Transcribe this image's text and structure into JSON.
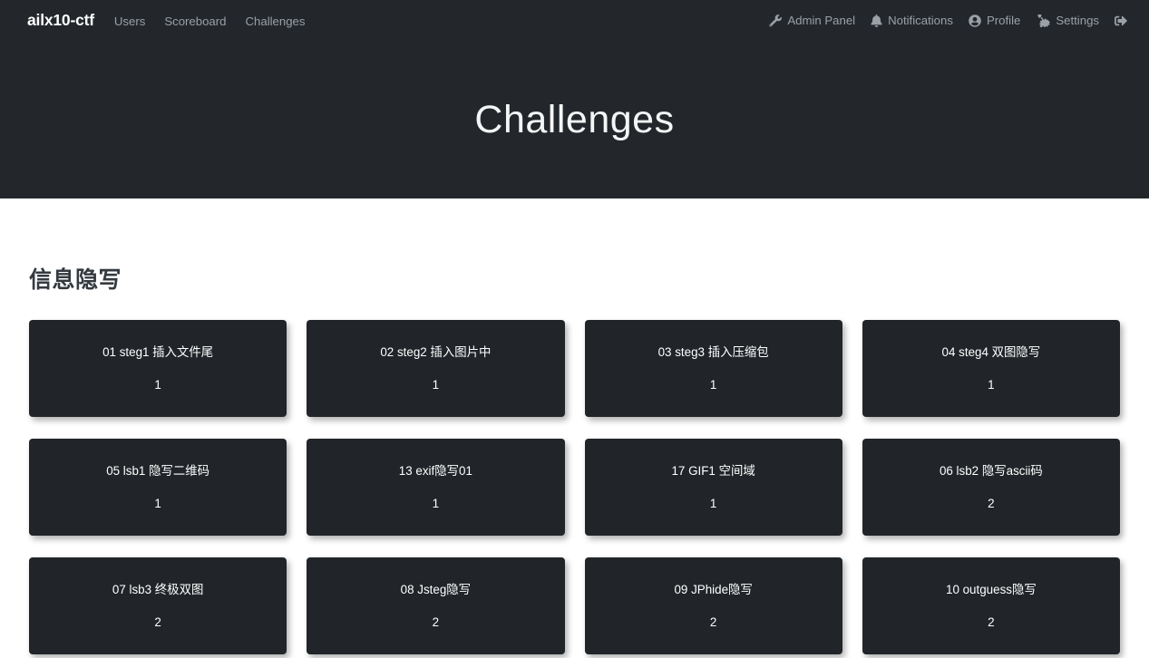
{
  "navbar": {
    "brand": "ailx10-ctf",
    "left_links": [
      {
        "label": "Users",
        "name": "nav-link-users"
      },
      {
        "label": "Scoreboard",
        "name": "nav-link-scoreboard"
      },
      {
        "label": "Challenges",
        "name": "nav-link-challenges"
      }
    ],
    "right_items": [
      {
        "label": "Admin Panel",
        "icon": "wrench-icon"
      },
      {
        "label": "Notifications",
        "icon": "bell-icon"
      },
      {
        "label": "Profile",
        "icon": "user-circle-icon"
      },
      {
        "label": "Settings",
        "icon": "gears-icon"
      },
      {
        "label": "",
        "icon": "sign-out-icon"
      }
    ]
  },
  "header": {
    "title": "Challenges",
    "background_color": "#23272b"
  },
  "main": {
    "category": "信息隐写",
    "challenges": [
      {
        "name": "01 steg1 插入文件尾",
        "value": "1"
      },
      {
        "name": "02 steg2 插入图片中",
        "value": "1"
      },
      {
        "name": "03 steg3 插入压缩包",
        "value": "1"
      },
      {
        "name": "04 steg4 双图隐写",
        "value": "1"
      },
      {
        "name": "05 lsb1 隐写二维码",
        "value": "1"
      },
      {
        "name": "13 exif隐写01",
        "value": "1"
      },
      {
        "name": "17 GIF1 空间域",
        "value": "1"
      },
      {
        "name": "06 lsb2 隐写ascii码",
        "value": "2"
      },
      {
        "name": "07 lsb3 终极双图",
        "value": "2"
      },
      {
        "name": "08 Jsteg隐写",
        "value": "2"
      },
      {
        "name": "09 JPhide隐写",
        "value": "2"
      },
      {
        "name": "10 outguess隐写",
        "value": "2"
      }
    ]
  },
  "colors": {
    "card_background": "#212529",
    "page_background": "#ffffff",
    "muted_text": "#9aa0a6",
    "heading_text": "#343a40"
  }
}
